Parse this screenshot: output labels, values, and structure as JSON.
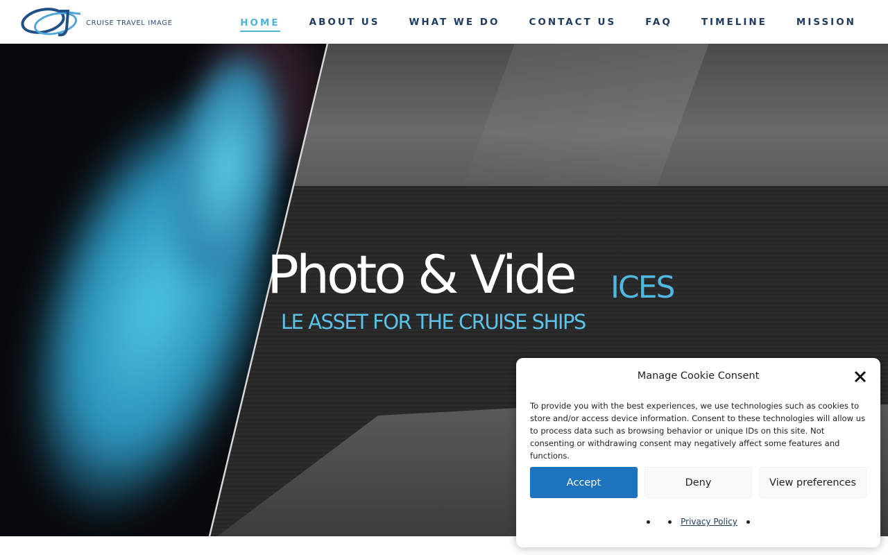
{
  "header": {
    "logo_text": "CRUISE TRAVEL IMAGE",
    "nav": [
      {
        "label": "HOME",
        "active": true
      },
      {
        "label": "ABOUT US",
        "active": false
      },
      {
        "label": "WHAT WE DO",
        "active": false
      },
      {
        "label": "CONTACT US",
        "active": false
      },
      {
        "label": "FAQ",
        "active": false
      },
      {
        "label": "TIMELINE",
        "active": false
      },
      {
        "label": "MISSION",
        "active": false
      }
    ]
  },
  "hero": {
    "title": "Photo & Vide",
    "title_suffix": "ICES",
    "subtitle": "LE ASSET FOR THE CRUISE SHIPS"
  },
  "cookie": {
    "title": "Manage Cookie Consent",
    "close_icon": "close-icon",
    "text": "To provide you with the best experiences, we use technologies such as cookies to store and/or access device information. Consent to these technologies will allow us to process data such as browsing behavior or unique IDs on this site. Not consenting or withdrawing consent may negatively affect some features and functions.",
    "accept_label": "Accept",
    "deny_label": "Deny",
    "preferences_label": "View preferences",
    "privacy_link": "Privacy Policy"
  },
  "colors": {
    "brand_dark": "#1e3b5e",
    "accent": "#4fb3d9",
    "button_primary": "#1e73be"
  }
}
